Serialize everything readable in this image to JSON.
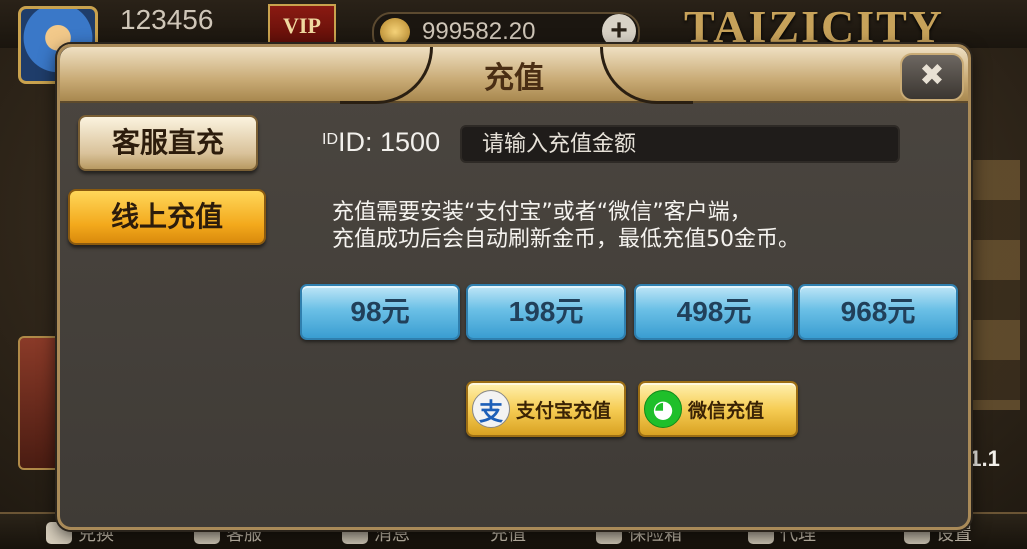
{
  "lobby": {
    "user_id": "123456",
    "vip_label": "VIP",
    "coins": "999582.20",
    "coin_add": "+",
    "brand": "TAIZICITY",
    "version": "v1.1",
    "bottom_nav": [
      {
        "label": "兑换",
        "icon": "exchange-icon"
      },
      {
        "label": "客服",
        "icon": "service-icon"
      },
      {
        "label": "消息",
        "icon": "mail-icon"
      },
      {
        "label": "充值",
        "icon": "recharge-icon"
      },
      {
        "label": "保险箱",
        "icon": "safe-icon"
      },
      {
        "label": "代理",
        "icon": "agent-icon"
      },
      {
        "label": "设置",
        "icon": "settings-icon"
      }
    ]
  },
  "dialog": {
    "title": "充值",
    "close_glyph": "✖",
    "tabs": [
      {
        "label": "客服直充",
        "active": false
      },
      {
        "label": "线上充值",
        "active": true
      }
    ],
    "id_prefix": "ID",
    "id_label": "ID: ",
    "id_value": "1500",
    "amount_placeholder": "请输入充值金额",
    "notice_line1": "充值需要安装“支付宝”或者“微信”客户端，",
    "notice_line2": "充值成功后会自动刷新金币，最低充值50金币。",
    "amounts": [
      "98元",
      "198元",
      "498元",
      "968元"
    ],
    "pay_buttons": [
      {
        "label": "支付宝充值",
        "icon": "alipay-icon",
        "glyph": "支"
      },
      {
        "label": "微信充值",
        "icon": "wechat-icon",
        "glyph": "◕"
      }
    ]
  },
  "colors": {
    "amount_button": "#6bc0e6",
    "pay_button": "#f6cd55",
    "active_tab": "#f3a91c",
    "header": "#c9ab76"
  }
}
